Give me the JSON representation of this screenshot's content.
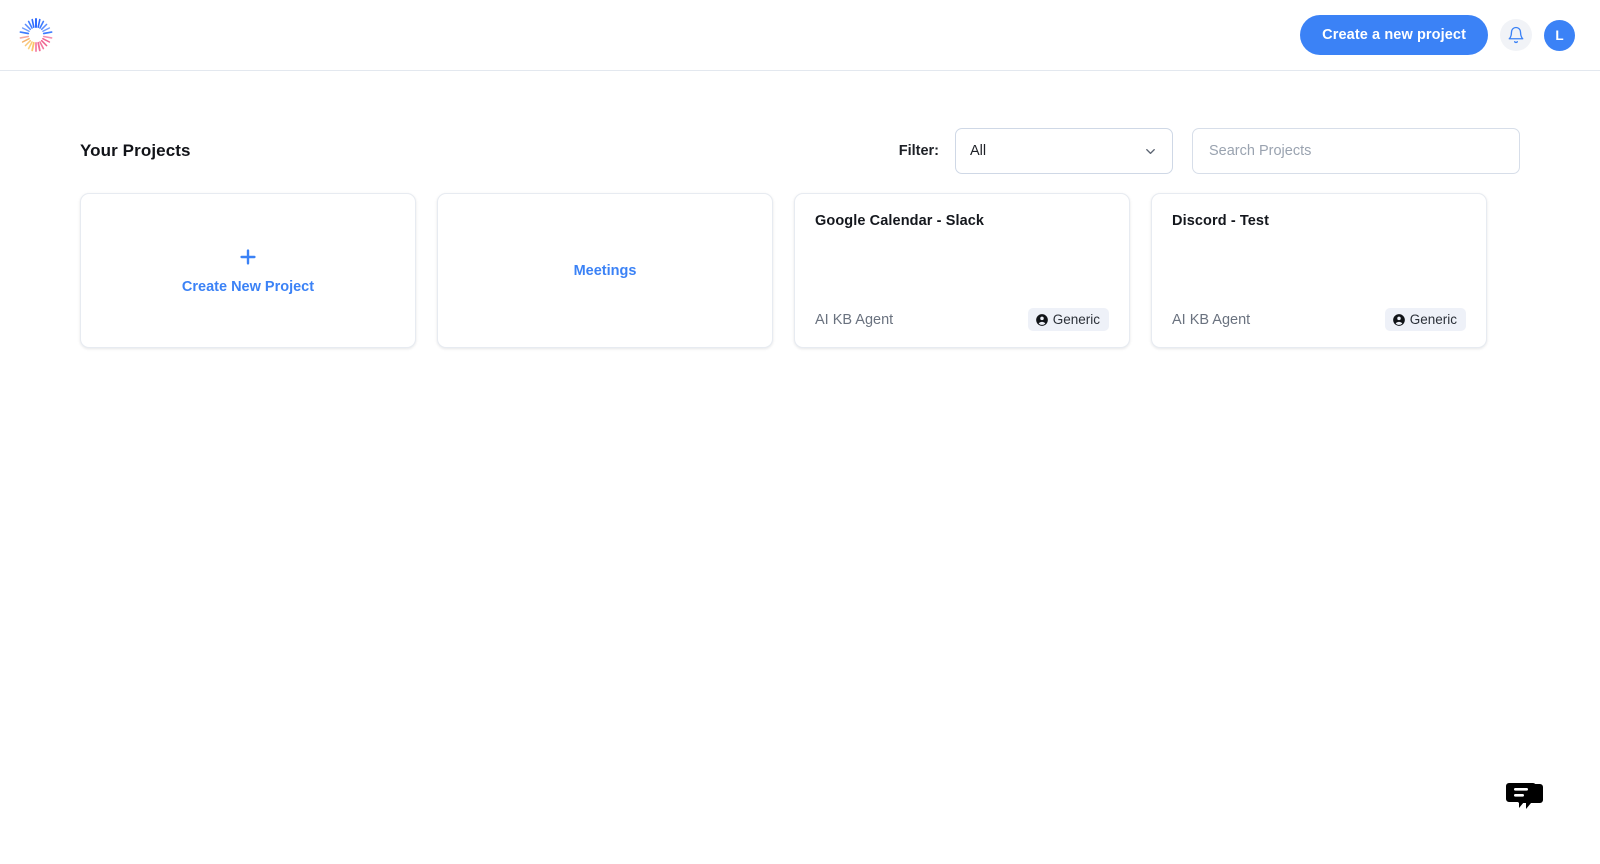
{
  "header": {
    "logo_name": "radial-burst-logo",
    "create_project_button": "Create a new project",
    "notifications_icon": "bell-icon",
    "avatar_initial": "L",
    "accent_color": "#3b82f6",
    "border_color": "#e3e8ef"
  },
  "toolbar": {
    "page_title": "Your Projects",
    "filter_label": "Filter:",
    "filter_value": "All",
    "filter_options": [
      "All"
    ],
    "search_placeholder": "Search Projects",
    "search_value": ""
  },
  "cards": [
    {
      "kind": "create",
      "icon": "plus-icon",
      "label": "Create New Project"
    },
    {
      "kind": "link",
      "label": "Meetings"
    },
    {
      "kind": "project",
      "title": "Google Calendar - Slack",
      "subtitle": "AI KB Agent",
      "badge_label": "Generic",
      "badge_icon": "user-circle-icon"
    },
    {
      "kind": "project",
      "title": "Discord - Test",
      "subtitle": "AI KB Agent",
      "badge_label": "Generic",
      "badge_icon": "user-circle-icon"
    }
  ],
  "chat": {
    "icon": "chat-bubbles-icon",
    "color": "#000000"
  }
}
